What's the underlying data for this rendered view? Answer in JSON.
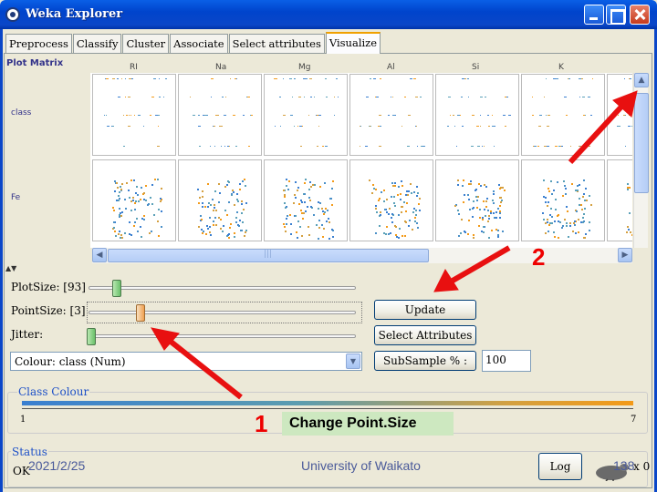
{
  "window": {
    "title": "Weka Explorer"
  },
  "tabs": [
    {
      "label": "Preprocess"
    },
    {
      "label": "Classify"
    },
    {
      "label": "Cluster"
    },
    {
      "label": "Associate"
    },
    {
      "label": "Select attributes"
    },
    {
      "label": "Visualize",
      "active": true
    }
  ],
  "plot_matrix": {
    "title": "Plot Matrix",
    "columns": [
      "RI",
      "Na",
      "Mg",
      "Al",
      "Si",
      "K"
    ],
    "rows": [
      "class",
      "Fe"
    ]
  },
  "controls": {
    "plot_size": {
      "label": "PlotSize: [93]"
    },
    "point_size": {
      "label": "PointSize: [3]"
    },
    "jitter": {
      "label": "Jitter:"
    },
    "colour": {
      "value": "Colour: class (Num)"
    },
    "update_button": "Update",
    "select_attributes_button": "Select Attributes",
    "subsample_button": "SubSample % :",
    "subsample_value": "100"
  },
  "class_colour": {
    "legend": "Class Colour",
    "min": "1",
    "max": "7",
    "gradient_start": "#3a7fd0",
    "gradient_end": "#f39a18"
  },
  "status": {
    "legend": "Status",
    "text": "OK",
    "log_button": "Log",
    "count": "x 0"
  },
  "slide": {
    "caption": "Change Point.Size",
    "label_1": "1",
    "label_2": "2",
    "date": "2021/2/25",
    "institution": "University of Waikato",
    "page": "138",
    "arrow_color": "#e81010"
  }
}
